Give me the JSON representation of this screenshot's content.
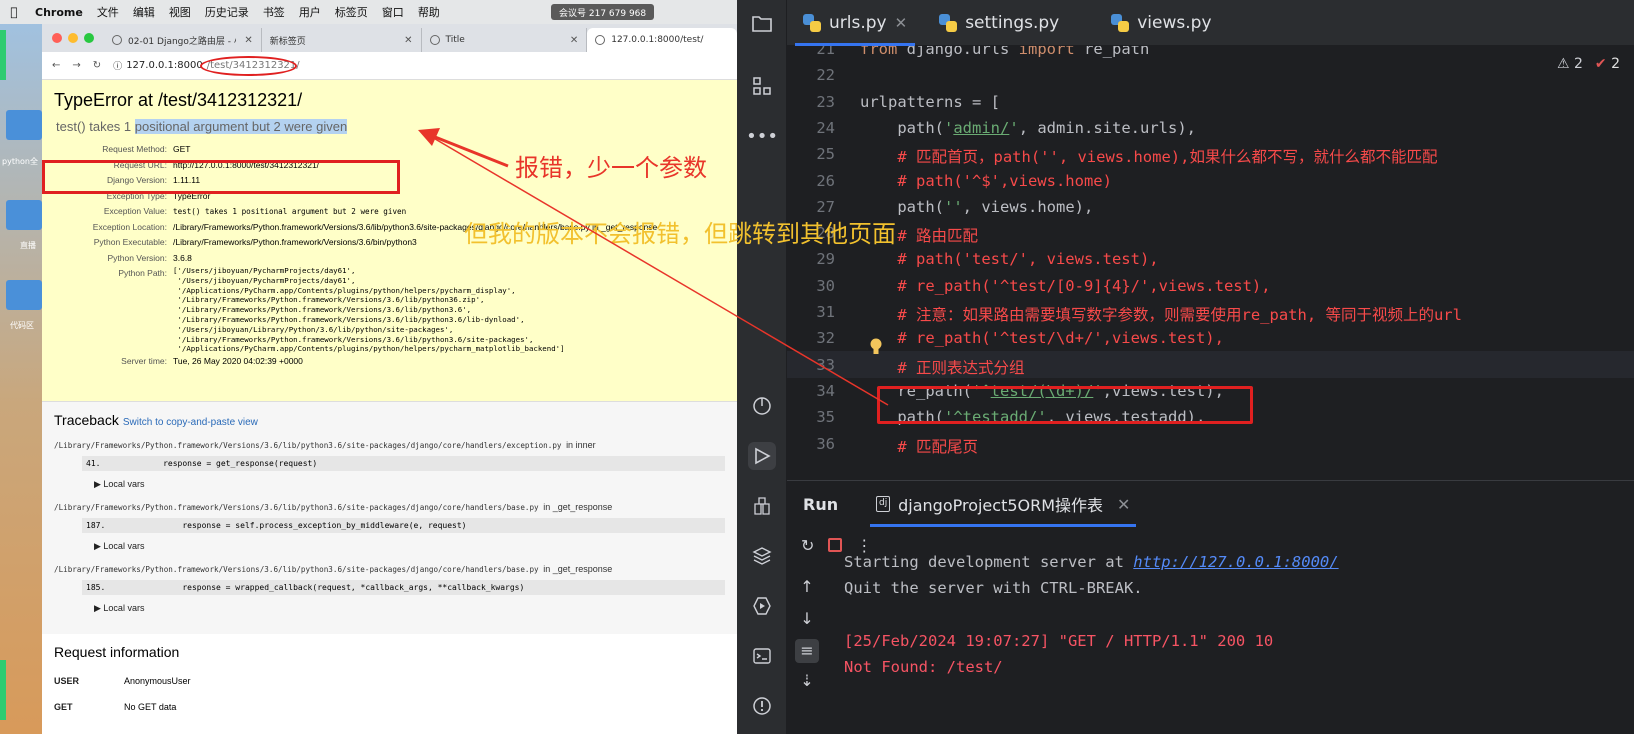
{
  "mac": {
    "menu": [
      "Chrome",
      "文件",
      "编辑",
      "视图",
      "历史记录",
      "书签",
      "用户",
      "标签页",
      "窗口",
      "帮助"
    ],
    "meeting_badge": "会议号 217 679 968",
    "desktop_labels": [
      "python全",
      "直播",
      "代码区"
    ]
  },
  "browser": {
    "tabs": [
      {
        "label": "02-01 Django之路由层 - 小猿"
      },
      {
        "label": "新标签页"
      },
      {
        "label": "Title"
      },
      {
        "label": "127.0.0.1:8000/test/"
      }
    ],
    "url_host": "127.0.0.1:8000",
    "url_path": "/test/3412312321/"
  },
  "error": {
    "title": "TypeError at /test/3412312321/",
    "message_pre": "test() takes 1",
    "message_hl": "positional argument but 2 were given",
    "meta": [
      {
        "k": "Request Method:",
        "v": "GET"
      },
      {
        "k": "Request URL:",
        "v": "http://127.0.0.1:8000/test/3412312321/"
      },
      {
        "k": "Django Version:",
        "v": "1.11.11"
      },
      {
        "k": "Exception Type:",
        "v": "TypeError"
      },
      {
        "k": "Exception Value:",
        "v": "test() takes 1 positional argument but 2 were given"
      },
      {
        "k": "Exception Location:",
        "v": "/Library/Frameworks/Python.framework/Versions/3.6/lib/python3.6/site-packages/django/core/handlers/base.py in _get_response"
      },
      {
        "k": "Python Executable:",
        "v": "/Library/Frameworks/Python.framework/Versions/3.6/bin/python3"
      },
      {
        "k": "Python Version:",
        "v": "3.6.8"
      }
    ],
    "python_path_label": "Python Path:",
    "python_path": "['/Users/jiboyuan/PycharmProjects/day61',\n '/Users/jiboyuan/PycharmProjects/day61',\n '/Applications/PyCharm.app/Contents/plugins/python/helpers/pycharm_display',\n '/Library/Frameworks/Python.framework/Versions/3.6/lib/python36.zip',\n '/Library/Frameworks/Python.framework/Versions/3.6/lib/python3.6',\n '/Library/Frameworks/Python.framework/Versions/3.6/lib/python3.6/lib-dynload',\n '/Users/jiboyuan/Library/Python/3.6/lib/python/site-packages',\n '/Library/Frameworks/Python.framework/Versions/3.6/lib/python3.6/site-packages',\n '/Applications/PyCharm.app/Contents/plugins/python/helpers/pycharm_matplotlib_backend']",
    "server_time_label": "Server time:",
    "server_time": "Tue, 26 May 2020 04:02:39 +0000"
  },
  "traceback": {
    "title": "Traceback",
    "switch_link": "Switch to copy-and-paste view",
    "frames": [
      {
        "file": "/Library/Frameworks/Python.framework/Versions/3.6/lib/python3.6/site-packages/django/core/handlers/exception.py",
        "fn": "in inner",
        "code": "41.             response = get_response(request)",
        "local": "▶ Local vars"
      },
      {
        "file": "/Library/Frameworks/Python.framework/Versions/3.6/lib/python3.6/site-packages/django/core/handlers/base.py",
        "fn": "in _get_response",
        "code": "187.                response = self.process_exception_by_middleware(e, request)",
        "local": "▶ Local vars"
      },
      {
        "file": "/Library/Frameworks/Python.framework/Versions/3.6/lib/python3.6/site-packages/django/core/handlers/base.py",
        "fn": "in _get_response",
        "code": "185.                response = wrapped_callback(request, *callback_args, **callback_kwargs)",
        "local": "▶ Local vars"
      }
    ]
  },
  "request_info": {
    "title": "Request information",
    "rows": [
      {
        "k": "USER",
        "v": "AnonymousUser"
      },
      {
        "k": "GET",
        "v": "No GET data"
      }
    ]
  },
  "annotations": {
    "red": "报错，少一个参数",
    "yellow": "但我的版本不会报错，但跳转到其他页面"
  },
  "ide": {
    "tabs": [
      {
        "label": "urls.py",
        "active": true
      },
      {
        "label": "settings.py",
        "active": false
      },
      {
        "label": "views.py",
        "active": false
      }
    ],
    "inspections": {
      "warnings": "2",
      "weak": "2"
    },
    "lines": [
      {
        "n": "21",
        "html": "<span class='kw'>from</span> django.urls <span class='kw'>import</span> re_path"
      },
      {
        "n": "22",
        "html": ""
      },
      {
        "n": "23",
        "html": "urlpatterns = ["
      },
      {
        "n": "24",
        "html": "    path(<span class='str'>'<span class='ul'>admin/</span>'</span>, admin.site.urls),"
      },
      {
        "n": "25",
        "html": "    <span class='cmt'># 匹配首页，path('', views.home),如果什么都不写，就什么都不能匹配</span>"
      },
      {
        "n": "26",
        "html": "    <span class='cmt'># path('^$',views.home)</span>"
      },
      {
        "n": "27",
        "html": "    path(<span class='str'>''</span>, views.home),"
      },
      {
        "n": "28",
        "html": "    <span class='cmt'># 路由匹配</span>"
      },
      {
        "n": "29",
        "html": "    <span class='cmt'># path('test/', views.test),</span>"
      },
      {
        "n": "30",
        "html": "    <span class='cmt'># re_path('^test/[0-9]{4}/',views.test),</span>"
      },
      {
        "n": "31",
        "html": "    <span class='cmt'># 注意：如果路由需要填写数字参数，则需要使用re_path, 等同于视频上的url</span>"
      },
      {
        "n": "32",
        "html": "    <span class='cmt'># re_path('^test/\\d+/',views.test),</span>"
      },
      {
        "n": "33",
        "html": "    <span class='cmt'># 正则表达式分组</span>"
      },
      {
        "n": "34",
        "html": "    re_path(<span class='str'>'^<span class='ul'>test/(\\d+)/</span>'</span>,views.test),"
      },
      {
        "n": "35",
        "html": "    path(<span class='str'>'<span class='ul'>^testadd/</span>'</span>, views.testadd),"
      },
      {
        "n": "36",
        "html": "    <span class='cmt'># 匹配尾页</span>"
      }
    ],
    "run": {
      "title": "Run",
      "config": "djangoProject5ORM操作表",
      "out_line1_pre": "Starting development server at ",
      "out_line1_link": "http://127.0.0.1:8000/",
      "out_line2": "Quit the server with CTRL-BREAK.",
      "out_line3": "[25/Feb/2024 19:07:27] \"GET / HTTP/1.1\" 200 10",
      "out_line4": "Not Found: /test/"
    }
  },
  "colors": {
    "annotation_red": "#e8352a",
    "annotation_yellow": "#f2c12e",
    "error_bg": "#ffffc8",
    "ide_bg": "#1e1f22"
  }
}
